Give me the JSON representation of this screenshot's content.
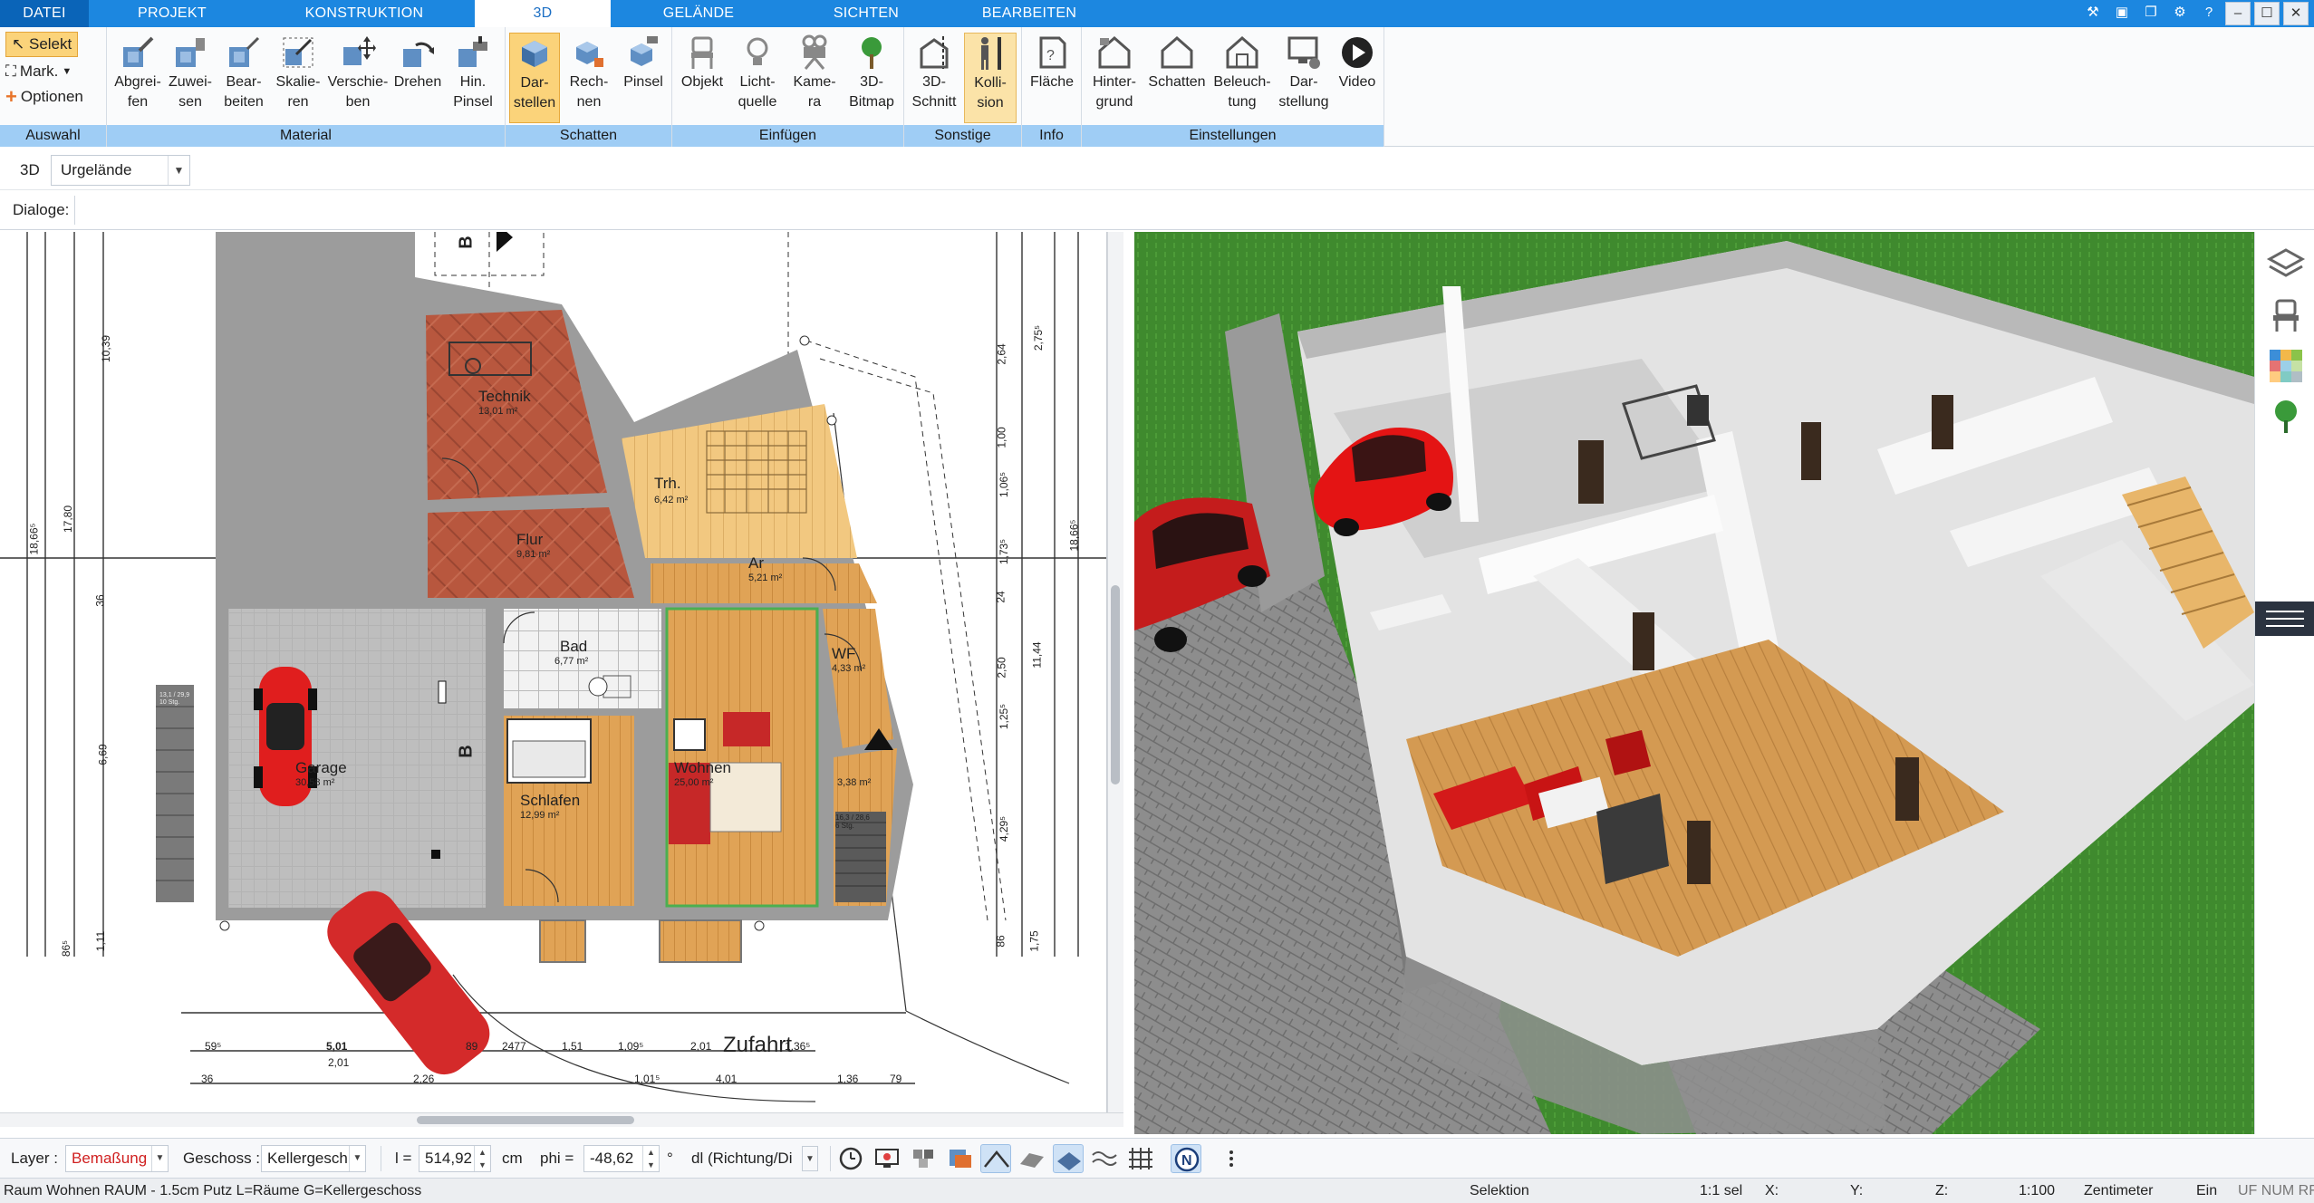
{
  "menu": {
    "tabs": [
      "DATEI",
      "PROJEKT",
      "KONSTRUKTION",
      "3D",
      "GELÄNDE",
      "SICHTEN",
      "BEARBEITEN"
    ],
    "active": "3D"
  },
  "ribbon": {
    "auswahl": {
      "label": "Auswahl",
      "selekt": "Selekt",
      "mark": "Mark.",
      "optionen": "Optionen"
    },
    "material": {
      "label": "Material",
      "buttons": [
        "Abgrei-\nfen",
        "Zuwei-\nsen",
        "Bear-\nbeiten",
        "Skalie-\nren",
        "Verschie-\nben",
        "Drehen",
        "Hin.\nPinsel"
      ]
    },
    "schatten": {
      "label": "Schatten",
      "buttons": [
        "Dar-\nstellen",
        "Rech-\nnen",
        "Pinsel"
      ]
    },
    "einfuegen": {
      "label": "Einfügen",
      "buttons": [
        "Objekt",
        "Licht-\nquelle",
        "Kame-\nra",
        "3D-\nBitmap"
      ]
    },
    "sonstige": {
      "label": "Sonstige",
      "buttons": [
        "3D-\nSchnitt",
        "Kolli-\nsion"
      ]
    },
    "info": {
      "label": "Info",
      "buttons": [
        "Fläche"
      ]
    },
    "einstellungen": {
      "label": "Einstellungen",
      "buttons": [
        "Hinter-\ngrund",
        "Schatten",
        "Beleuch-\ntung",
        "Dar-\nstellung",
        "Video"
      ]
    }
  },
  "row3d": {
    "mode": "3D",
    "terrain": "Urgelände"
  },
  "dialoge": {
    "label": "Dialoge:"
  },
  "plan": {
    "rooms": [
      {
        "name": "Technik",
        "area": "13,01 m²"
      },
      {
        "name": "Trh.",
        "area": "6,42 m²"
      },
      {
        "name": "Flur",
        "area": "9,81 m²"
      },
      {
        "name": "Ar",
        "area": "5,21 m²"
      },
      {
        "name": "Bad",
        "area": "6,77 m²"
      },
      {
        "name": "WF",
        "area": "4,33 m²"
      },
      {
        "name": "Garage",
        "area": "30,58 m²"
      },
      {
        "name": "Wohnen",
        "area": "25,00 m²"
      },
      {
        "name": "Schlafen",
        "area": "12,99 m²"
      },
      {
        "name": "",
        "area": "3,38 m²"
      }
    ],
    "driveway": "Zufahrt",
    "dims_left": [
      "10,39",
      "17,80",
      "18,66⁵",
      "6,69",
      "36",
      "86⁵",
      "1,11"
    ],
    "dims_right": [
      "2,64",
      "2,75⁵",
      "1,00",
      "1,06⁵",
      "1,73⁵",
      "24",
      "2,50",
      "11,44",
      "1,25⁵",
      "4,29⁵",
      "86",
      "1,75",
      "18,66⁵"
    ],
    "dims_bottom_1": [
      "59⁵",
      "5,01",
      "89",
      "2477",
      "1,51",
      "1,09⁵",
      "2,01",
      "1,36⁵"
    ],
    "dims_bottom_2": [
      "2,01",
      "2,26"
    ],
    "dims_bottom_3": [
      "36",
      "1,01⁵",
      "4,01",
      "1,36",
      "79"
    ],
    "section_marks": [
      "B",
      "B"
    ],
    "stair_note": "16,3 / 28,6\n6 Stg.",
    "stair_note_left": "13,1 / 29,9\n10 Stg."
  },
  "bottom": {
    "layer_label": "Layer :",
    "layer_value": "Bemaßung",
    "geschoss_label": "Geschoss :",
    "geschoss_value": "Kellergesch",
    "l_label": "l =",
    "l_value": "514,92",
    "l_unit": "cm",
    "phi_label": "phi =",
    "phi_value": "-48,62",
    "phi_unit": "°",
    "dl_value": "dl (Richtung/Di"
  },
  "status": {
    "info": "Raum Wohnen RAUM - 1.5cm Putz L=Räume G=Kellergeschoss",
    "mode": "Selektion",
    "sel": "1:1 sel",
    "x": "X:",
    "y": "Y:",
    "z": "Z:",
    "scale": "1:100",
    "unit": "Zentimeter",
    "ein": "Ein",
    "flags": "UF NUM RF"
  },
  "colors": {
    "accent": "#1c87e0",
    "ribbon_group": "#9fcdf5",
    "active_button": "#fbd37a",
    "layer_text": "#d02020"
  }
}
